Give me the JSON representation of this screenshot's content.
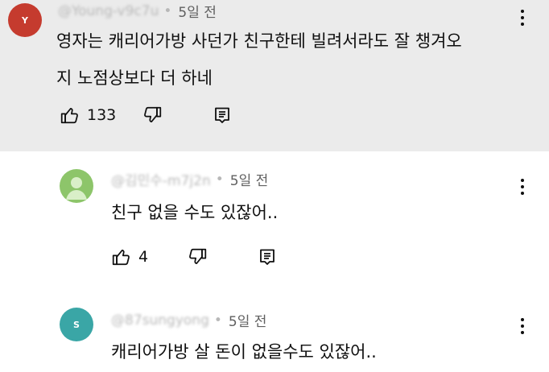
{
  "comments": [
    {
      "avatar_letter": "Y",
      "handle": "@Young-v9c7u",
      "time": "5일 전",
      "text": "영자는 캐리어가방 사던가 친구한테 빌려서라도 잘 챙겨오\n지 노점상보다 더 하네",
      "likes": "133"
    },
    {
      "avatar_letter": "",
      "handle": "@김민수-m7j2n",
      "time": "5일 전",
      "text": "친구 없을 수도 있잖어..",
      "likes": "4"
    },
    {
      "avatar_letter": "S",
      "handle": "@87sungyong",
      "time": "5일 전",
      "text": "캐리어가방 살 돈이 없을수도 있잖어.."
    }
  ],
  "separator": "•",
  "icons": {
    "like": "thumbs-up-icon",
    "dislike": "thumbs-down-icon",
    "reply": "reply-icon",
    "menu": "more-vert-icon"
  },
  "colors": {
    "highlight_bg": "#ebebeb",
    "avatar_1": "#c53b2e",
    "avatar_2": "#8dc56a",
    "avatar_3": "#3aa6a6"
  }
}
